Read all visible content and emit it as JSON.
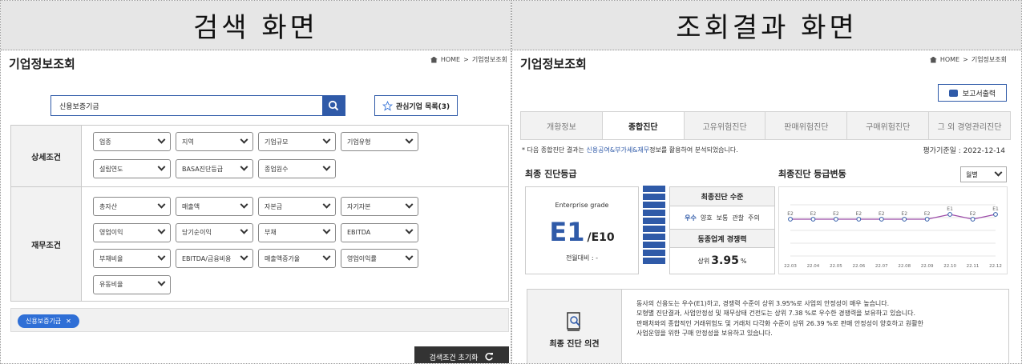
{
  "left": {
    "header": "검색 화면",
    "title": "기업정보조회",
    "breadcrumb": {
      "home": "HOME",
      "sep": ">",
      "current": "기업정보조회"
    },
    "search": {
      "value": "신용보증기금"
    },
    "fav_button": "관심기업 목록(3)",
    "detail_label": "상세조건",
    "detail_selects": [
      "업종",
      "지역",
      "기업규모",
      "기업유형",
      "설립연도",
      "BASA진단등급",
      "종업원수"
    ],
    "finance_label": "재무조건",
    "finance_selects": [
      "총자산",
      "매출액",
      "자본금",
      "자기자본",
      "영업이익",
      "당기순이익",
      "부채",
      "EBITDA",
      "부채비율",
      "EBITDA/금융비용",
      "매출액증가율",
      "영업이익률",
      "유동비율"
    ],
    "tag": "신용보증기금",
    "reset_button": "검색조건 초기화"
  },
  "right": {
    "header": "조회결과 화면",
    "title": "기업정보조회",
    "breadcrumb": {
      "home": "HOME",
      "sep": ">",
      "current": "기업정보조회"
    },
    "print_button": "보고서출력",
    "tabs": [
      "개황정보",
      "종합진단",
      "고유위험진단",
      "판매위험진단",
      "구매위험진단",
      "그 외 경영관리진단"
    ],
    "active_tab": 1,
    "note": {
      "pre": "* 다음 종합진단 결과는 ",
      "hl": "신용공여&부가세&재무",
      "post": "정보를 활용하여 분석되었습니다."
    },
    "eval_date": "평가기준일 : 2022-12-14",
    "final_grade_title": "최종 진단등급",
    "grade": {
      "label": "Enterprise grade",
      "value": "E1",
      "of": "/E10",
      "prev_label": "전월대비 : -"
    },
    "level": {
      "head": "최종진단 수준",
      "items": [
        "우수",
        "양호",
        "보통",
        "관찰",
        "주의"
      ],
      "active": 0
    },
    "rank": {
      "head": "동종업계 경쟁력",
      "prefix": "상위",
      "value": "3.95",
      "unit": "%"
    },
    "trend_title": "최종진단 등급변동",
    "period": "월별",
    "opinion": {
      "label": "최종 진단 의견",
      "lines": [
        "동사의 신용도는 우수(E1)하고, 경쟁력 수준이 상위 3.95%로 사업의 안정성이 매우 높습니다.",
        "모형별 진단결과, 사업안정성 및 재무상태 건전도는 상위 7.38 %로 우수한 경쟁력을 보유하고 있습니다.",
        "판매처와의 종합적인 거래위험도 및 거래처 다각화 수준이 상위 26.39 %로 판매 안정성이 양호하고 원활한",
        "사업운영을 위한 구매 안정성을 보유하고 있습니다."
      ]
    }
  },
  "chart_data": {
    "type": "line",
    "x": [
      "22.03",
      "22.04",
      "22.05",
      "22.06",
      "22.07",
      "22.08",
      "22.09",
      "22.10",
      "22.11",
      "22.12"
    ],
    "series": [
      {
        "values": [
          "E2",
          "E2",
          "E2",
          "E2",
          "E2",
          "E2",
          "E2",
          "E1",
          "E2",
          "E1"
        ]
      }
    ],
    "grid": true,
    "colors": {
      "line": "#9b4aa8",
      "marker": "#2f5aa8"
    }
  }
}
